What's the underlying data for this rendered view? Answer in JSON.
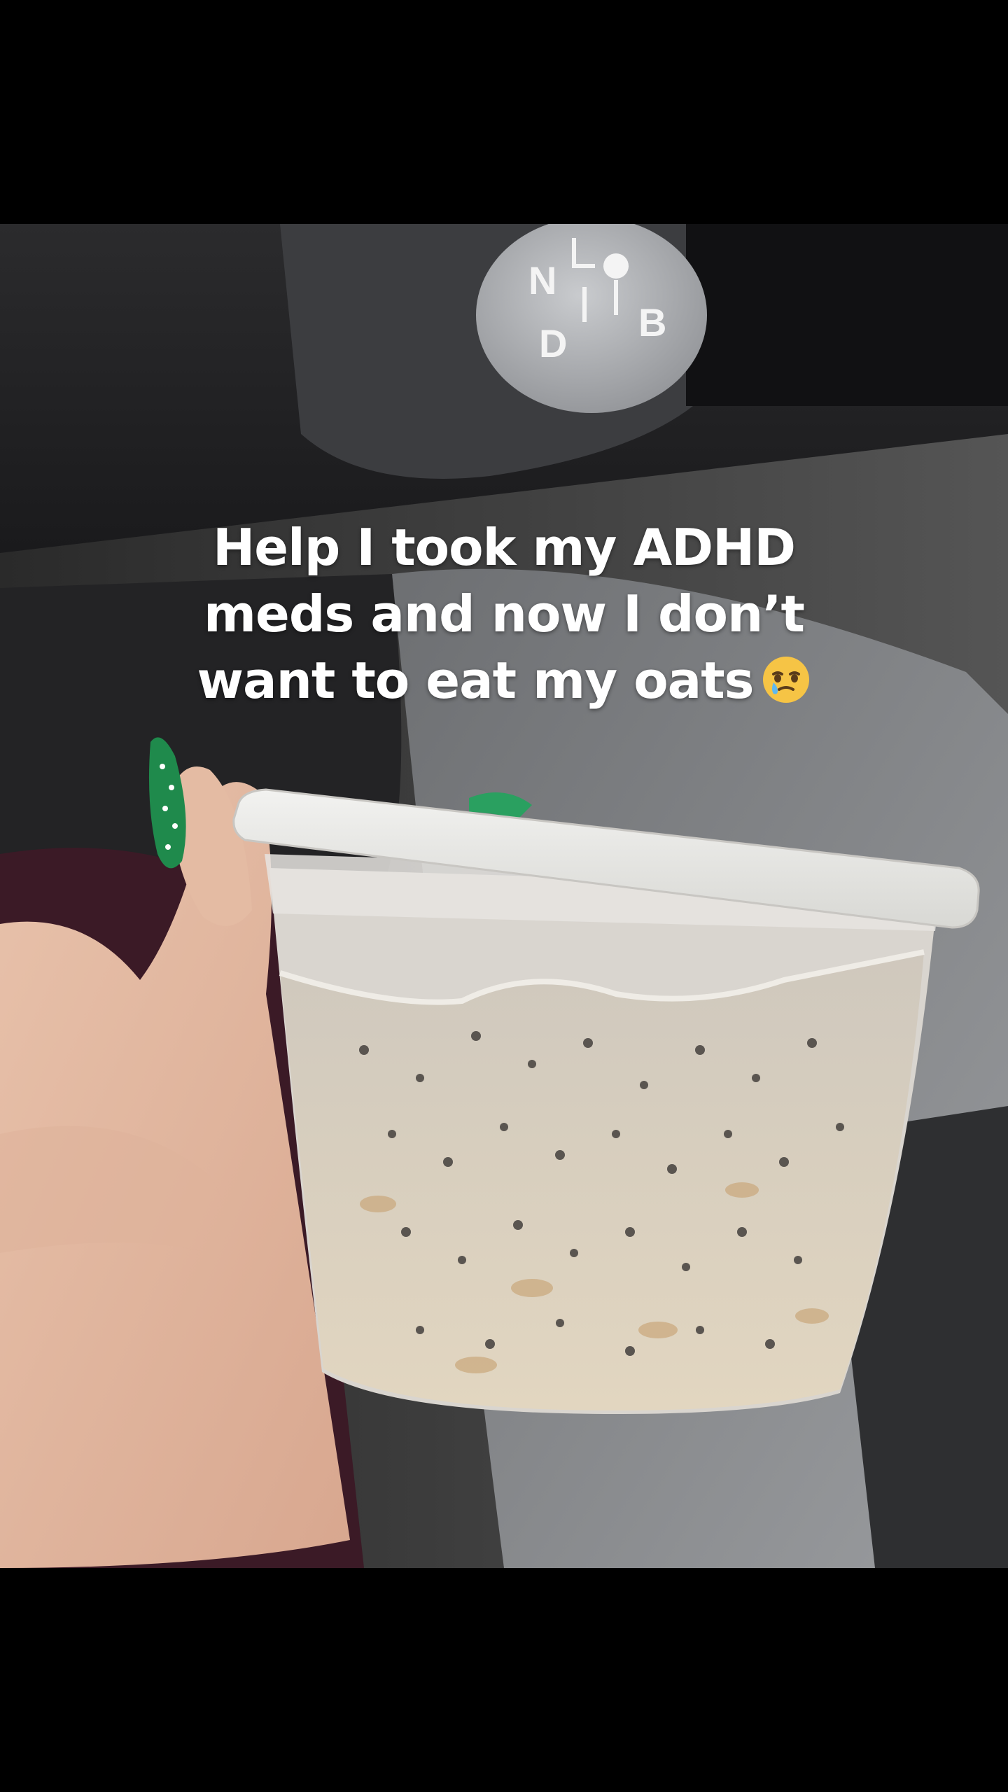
{
  "caption": {
    "lines": [
      "Help I took my ADHD",
      "meds and now I don’t",
      "want to eat my oats"
    ],
    "emoji_icon": "face-holding-back-tears-icon"
  },
  "photo": {
    "gear_knob_labels": [
      "N",
      "D",
      "B"
    ],
    "subject": "overnight oats in a plastic deli container held in hand inside a car"
  },
  "colors": {
    "background": "#000000",
    "caption_text": "#ffffff",
    "nail_green": "#1f8a4c",
    "pants": "#3b1a26"
  }
}
